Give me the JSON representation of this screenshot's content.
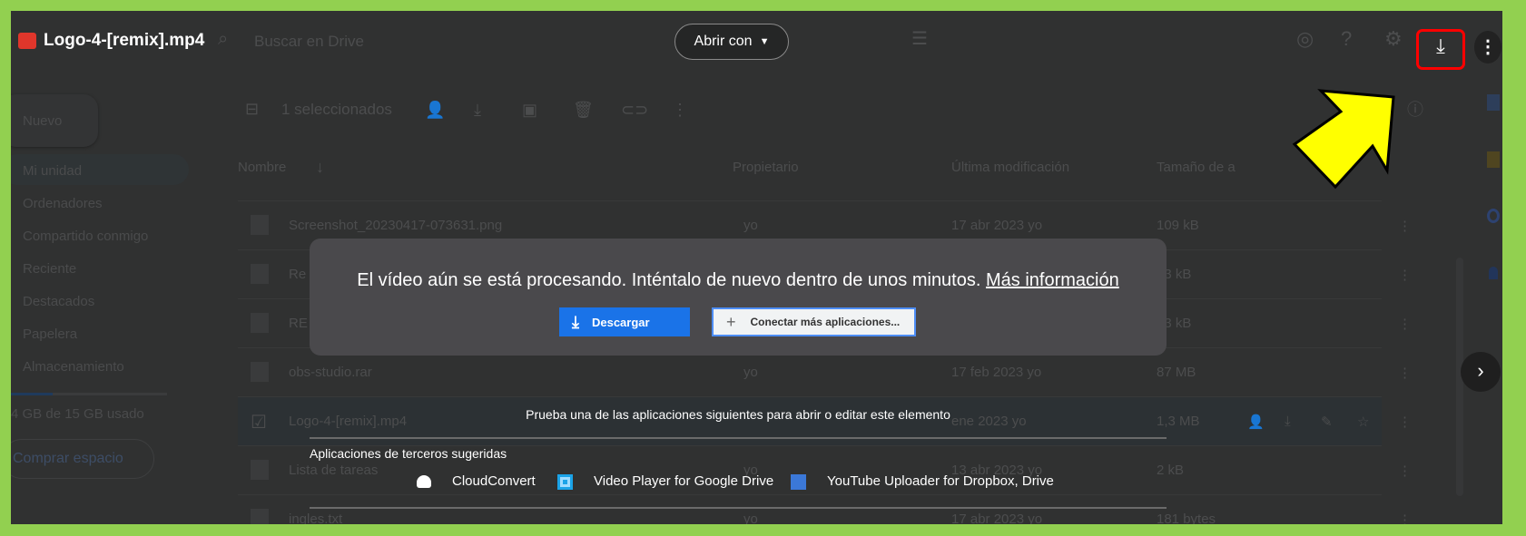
{
  "header": {
    "title": "Logo-4-[remix].mp4",
    "search_placeholder": "Buscar en Drive",
    "open_with": "Abrir con"
  },
  "toolbar": {
    "selected": "1 seleccionados"
  },
  "sidebar": {
    "new": "Nuevo",
    "items": [
      "Mi unidad",
      "Ordenadores",
      "Compartido conmigo",
      "Reciente",
      "Destacados",
      "Papelera",
      "Almacenamiento"
    ],
    "storage_text": "4 GB de 15 GB usado",
    "storage_used_fraction": 0.27,
    "buy": "Comprar espacio"
  },
  "table": {
    "headers": [
      "Nombre",
      "Propietario",
      "Última modificación",
      "Tamaño de a"
    ],
    "rows": [
      {
        "name": "Screenshot_20230417-073631.png",
        "owner": "yo",
        "modified": "17 abr 2023 yo",
        "size": "109 kB"
      },
      {
        "name": "Re",
        "owner": "",
        "modified": "",
        "size": "23 kB"
      },
      {
        "name": "RE",
        "owner": "",
        "modified": "",
        "size": "23 kB"
      },
      {
        "name": "obs-studio.rar",
        "owner": "yo",
        "modified": "17 feb 2023 yo",
        "size": "87 MB"
      },
      {
        "name": "Logo-4-[remix].mp4",
        "owner": "",
        "modified": "ene 2023 yo",
        "size": "1,3 MB"
      },
      {
        "name": "Lista de tareas",
        "owner": "yo",
        "modified": "13 abr 2023 yo",
        "size": "2 kB"
      },
      {
        "name": "ingles.txt",
        "owner": "yo",
        "modified": "17 abr 2023 yo",
        "size": "181 bytes"
      }
    ]
  },
  "dialog": {
    "message": "El vídeo aún se está procesando. Inténtalo de nuevo dentro de unos minutos.",
    "link": "Más información",
    "download": "Descargar",
    "connect": "Conectar más aplicaciones..."
  },
  "suggest": {
    "prompt": "Prueba una de las aplicaciones siguientes para abrir o editar este elemento",
    "heading": "Aplicaciones de terceros sugeridas",
    "apps": [
      "CloudConvert",
      "Video Player for Google Drive",
      "YouTube Uploader for Dropbox, Drive"
    ]
  },
  "colors": {
    "frame": "#92d050",
    "highlight_box": "#ff0000",
    "arrow": "#ffff00",
    "primary": "#1a73e8"
  }
}
